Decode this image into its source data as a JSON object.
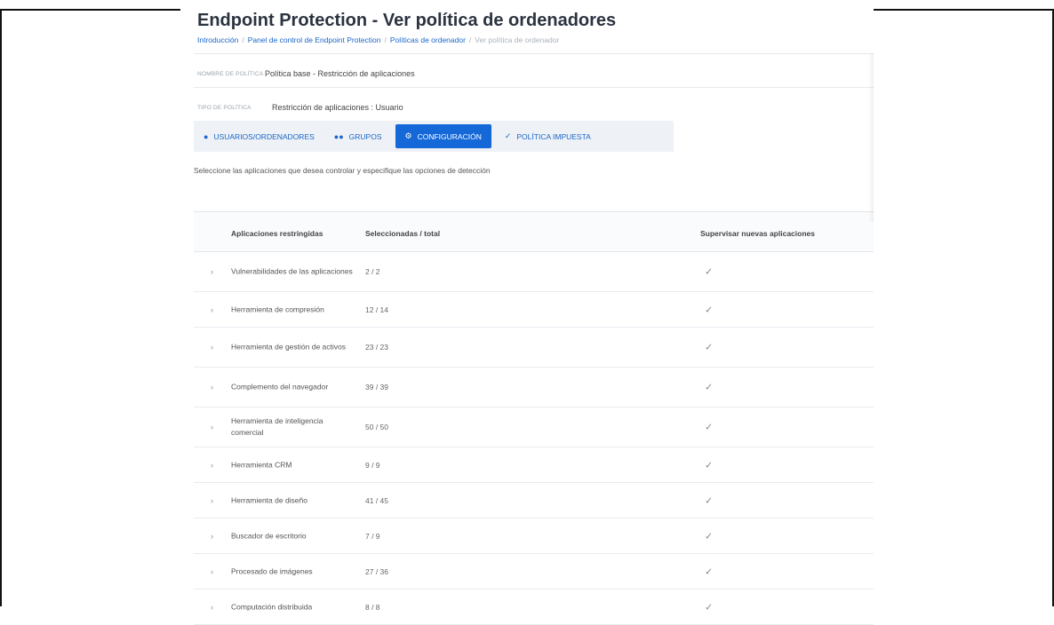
{
  "page": {
    "title": "Endpoint Protection - Ver política de ordenadores",
    "breadcrumb": [
      "Introducción",
      "Panel de control de Endpoint Protection",
      "Políticas de ordenador",
      "Ver política de ordenador"
    ]
  },
  "policy": {
    "name_label": "NOMBRE DE POLÍTICA",
    "name_value": "Política base - Restricción de aplicaciones",
    "type_label": "TIPO DE POLÍTICA",
    "type_value": "Restricción de aplicaciones : Usuario"
  },
  "tabs": [
    {
      "label": "USUARIOS/ORDENADORES",
      "icon": "user-icon",
      "active": false
    },
    {
      "label": "GRUPOS",
      "icon": "group-icon",
      "active": false
    },
    {
      "label": "CONFIGURACIÓN",
      "icon": "gear-icon",
      "active": true
    },
    {
      "label": "POLÍTICA IMPUESTA",
      "icon": "check-icon",
      "active": false
    }
  ],
  "description": "Seleccione las aplicaciones que desea controlar y especifique las opciones de detección",
  "table": {
    "headers": [
      "Aplicaciones restringidas",
      "Seleccionadas / total",
      "Supervisar nuevas aplicaciones"
    ],
    "rows": [
      {
        "name": "Vulnerabilidades de las aplicaciones",
        "count": "2 / 2",
        "monitor": true
      },
      {
        "name": "Herramienta de compresión",
        "count": "12 / 14",
        "monitor": true
      },
      {
        "name": "Herramienta de gestión de activos",
        "count": "23 / 23",
        "monitor": true
      },
      {
        "name": "Complemento del navegador",
        "count": "39 / 39",
        "monitor": true
      },
      {
        "name": "Herramienta de inteligencia comercial",
        "count": "50 / 50",
        "monitor": true
      },
      {
        "name": "Herramienta CRM",
        "count": "9 / 9",
        "monitor": true
      },
      {
        "name": "Herramienta de diseño",
        "count": "41 / 45",
        "monitor": true
      },
      {
        "name": "Buscador de escritorio",
        "count": "7 / 9",
        "monitor": true
      },
      {
        "name": "Procesado de imágenes",
        "count": "27 / 36",
        "monitor": true
      },
      {
        "name": "Computación distribuida",
        "count": "8 / 8",
        "monitor": true
      }
    ]
  },
  "colors": {
    "accent": "#1468d8",
    "link": "#1b66c9",
    "tab_bar": "#eef1f5"
  }
}
